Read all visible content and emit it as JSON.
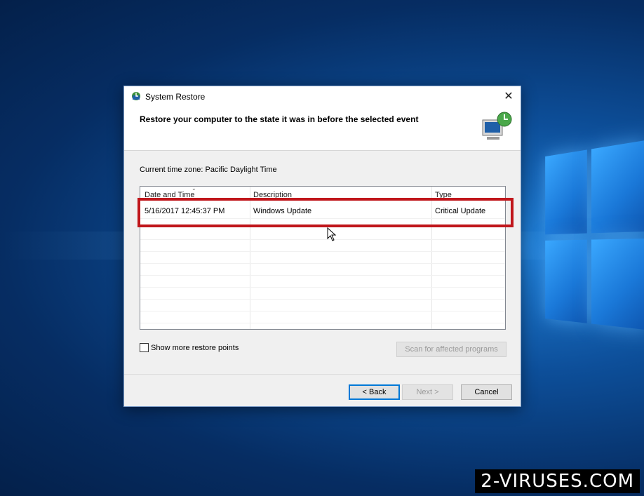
{
  "dialog": {
    "title": "System Restore",
    "close_glyph": "✕",
    "header": "Restore your computer to the state it was in before the selected event",
    "timezone": "Current time zone: Pacific Daylight Time",
    "columns": [
      "Date and Time",
      "Description",
      "Type"
    ],
    "rows": [
      {
        "date": "5/16/2017 12:45:37 PM",
        "description": "Windows Update",
        "type": "Critical Update"
      }
    ],
    "show_more_label": "Show more restore points",
    "scan_label": "Scan for affected programs",
    "back_label": "< Back",
    "next_label": "Next >",
    "cancel_label": "Cancel"
  },
  "watermark": "2-VIRUSES.COM",
  "colors": {
    "highlight": "#c0161b",
    "accent": "#0078d7"
  }
}
